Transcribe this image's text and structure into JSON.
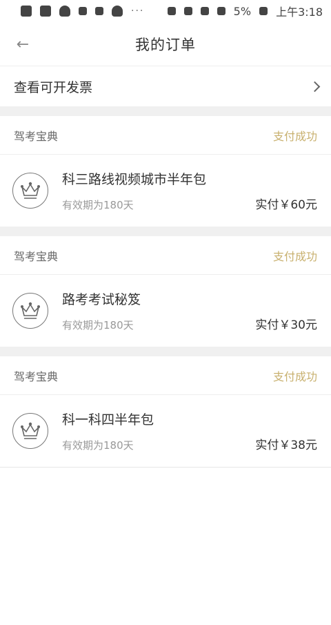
{
  "status_bar": {
    "dots": "···",
    "battery_pct": "5%",
    "time": "上午3:18"
  },
  "header": {
    "back_icon": "←",
    "title": "我的订单"
  },
  "invoice": {
    "label": "查看可开发票"
  },
  "orders": [
    {
      "shop": "驾考宝典",
      "status": "支付成功",
      "product": "科三路线视频城市半年包",
      "validity": "有效期为180天",
      "paid": "实付￥60元"
    },
    {
      "shop": "驾考宝典",
      "status": "支付成功",
      "product": "路考考试秘笈",
      "validity": "有效期为180天",
      "paid": "实付￥30元"
    },
    {
      "shop": "驾考宝典",
      "status": "支付成功",
      "product": "科一科四半年包",
      "validity": "有效期为180天",
      "paid": "实付￥38元"
    }
  ],
  "colors": {
    "status": "#c8b06e",
    "background_gap": "#f0f0f0"
  },
  "icons": {
    "order_badge": "crown-icon",
    "invoice_arrow": "chevron-right-icon"
  }
}
